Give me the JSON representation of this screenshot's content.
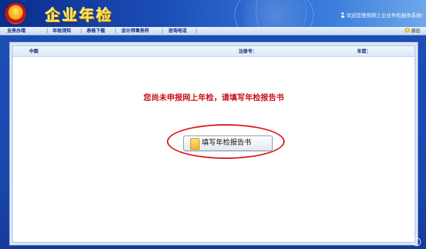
{
  "header": {
    "logo_text": "企业年检",
    "welcome_text": "欢迎您使用网上企业年检服务系统!"
  },
  "nav": {
    "items": [
      "业务办理",
      "年检须知",
      "表格下载",
      "会计师事务所",
      "咨询电话"
    ],
    "logout_label": "退出"
  },
  "info_bar": {
    "company_name": "中图",
    "reg_no_label": "注册号：",
    "year_label": "年度："
  },
  "notice": "您尚未申报网上年检，请填写年检报告书",
  "fill_button_label": "填写年检报告书",
  "colors": {
    "notice_red": "#c8101a",
    "ellipse_red": "#d91818",
    "nav_text": "#0a2f85"
  },
  "icons": [
    "emblem-icon",
    "person-icon",
    "logout-icon",
    "folder-icon"
  ]
}
